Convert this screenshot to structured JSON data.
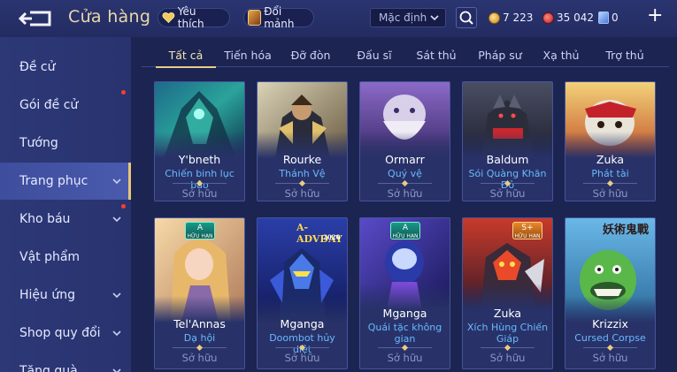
{
  "header": {
    "title": "Cửa hàng",
    "favorites_label": "Yêu thích",
    "shard_exchange_label": "Đổi mảnh",
    "sort_value": "Mặc định",
    "currencies": {
      "gold": "7 223",
      "ruby": "35 042",
      "voucher": "0"
    },
    "plus_label": "+"
  },
  "sidebar": {
    "items": [
      {
        "label": "Đề cử"
      },
      {
        "label": "Gói đề cử"
      },
      {
        "label": "Tướng"
      },
      {
        "label": "Trang phục"
      },
      {
        "label": "Kho báu"
      },
      {
        "label": "Vật phẩm"
      },
      {
        "label": "Hiệu ứng"
      },
      {
        "label": "Shop quy đổi"
      },
      {
        "label": "Tặng quà"
      }
    ]
  },
  "tabs": [
    {
      "label": "Tất cả"
    },
    {
      "label": "Tiến hóa"
    },
    {
      "label": "Đỡ đòn"
    },
    {
      "label": "Đấu sĩ"
    },
    {
      "label": "Sát thủ"
    },
    {
      "label": "Pháp sư"
    },
    {
      "label": "Xạ thủ"
    },
    {
      "label": "Trợ thủ"
    }
  ],
  "cards": [
    {
      "hero": "Y'bneth",
      "skin": "Chiến binh lục bảo",
      "status": "Sở hữu"
    },
    {
      "hero": "Rourke",
      "skin": "Thánh Vệ",
      "status": "Sở hữu"
    },
    {
      "hero": "Ormarr",
      "skin": "Quý vệ",
      "status": "Sở hữu"
    },
    {
      "hero": "Baldum",
      "skin": "Sói Quàng Khăn Đỏ",
      "status": "Sở hữu"
    },
    {
      "hero": "Zuka",
      "skin": "Phát tài",
      "status": "Sở hữu"
    },
    {
      "hero": "Tel'Annas",
      "skin": "Dạ hội",
      "status": "Sở hữu",
      "badge": "A",
      "badge_sub": "HỮU HẠN"
    },
    {
      "hero": "Mganga",
      "skin": "Doombot hủy diệt",
      "status": "Sở hữu",
      "art_text": "A-ADVDAY",
      "art_sub": "2020"
    },
    {
      "hero": "Mganga",
      "skin": "Quái tặc không gian",
      "status": "Sở hữu",
      "badge": "A",
      "badge_sub": "HỮU HẠN"
    },
    {
      "hero": "Zuka",
      "skin": "Xích Hùng Chiến Giáp",
      "status": "Sở hữu",
      "badge": "S+",
      "badge_sub": "HỮU HẠN"
    },
    {
      "hero": "Krizzix",
      "skin": "Cursed Corpse",
      "status": "Sở hữu",
      "art_text": "妖術鬼戰"
    }
  ]
}
